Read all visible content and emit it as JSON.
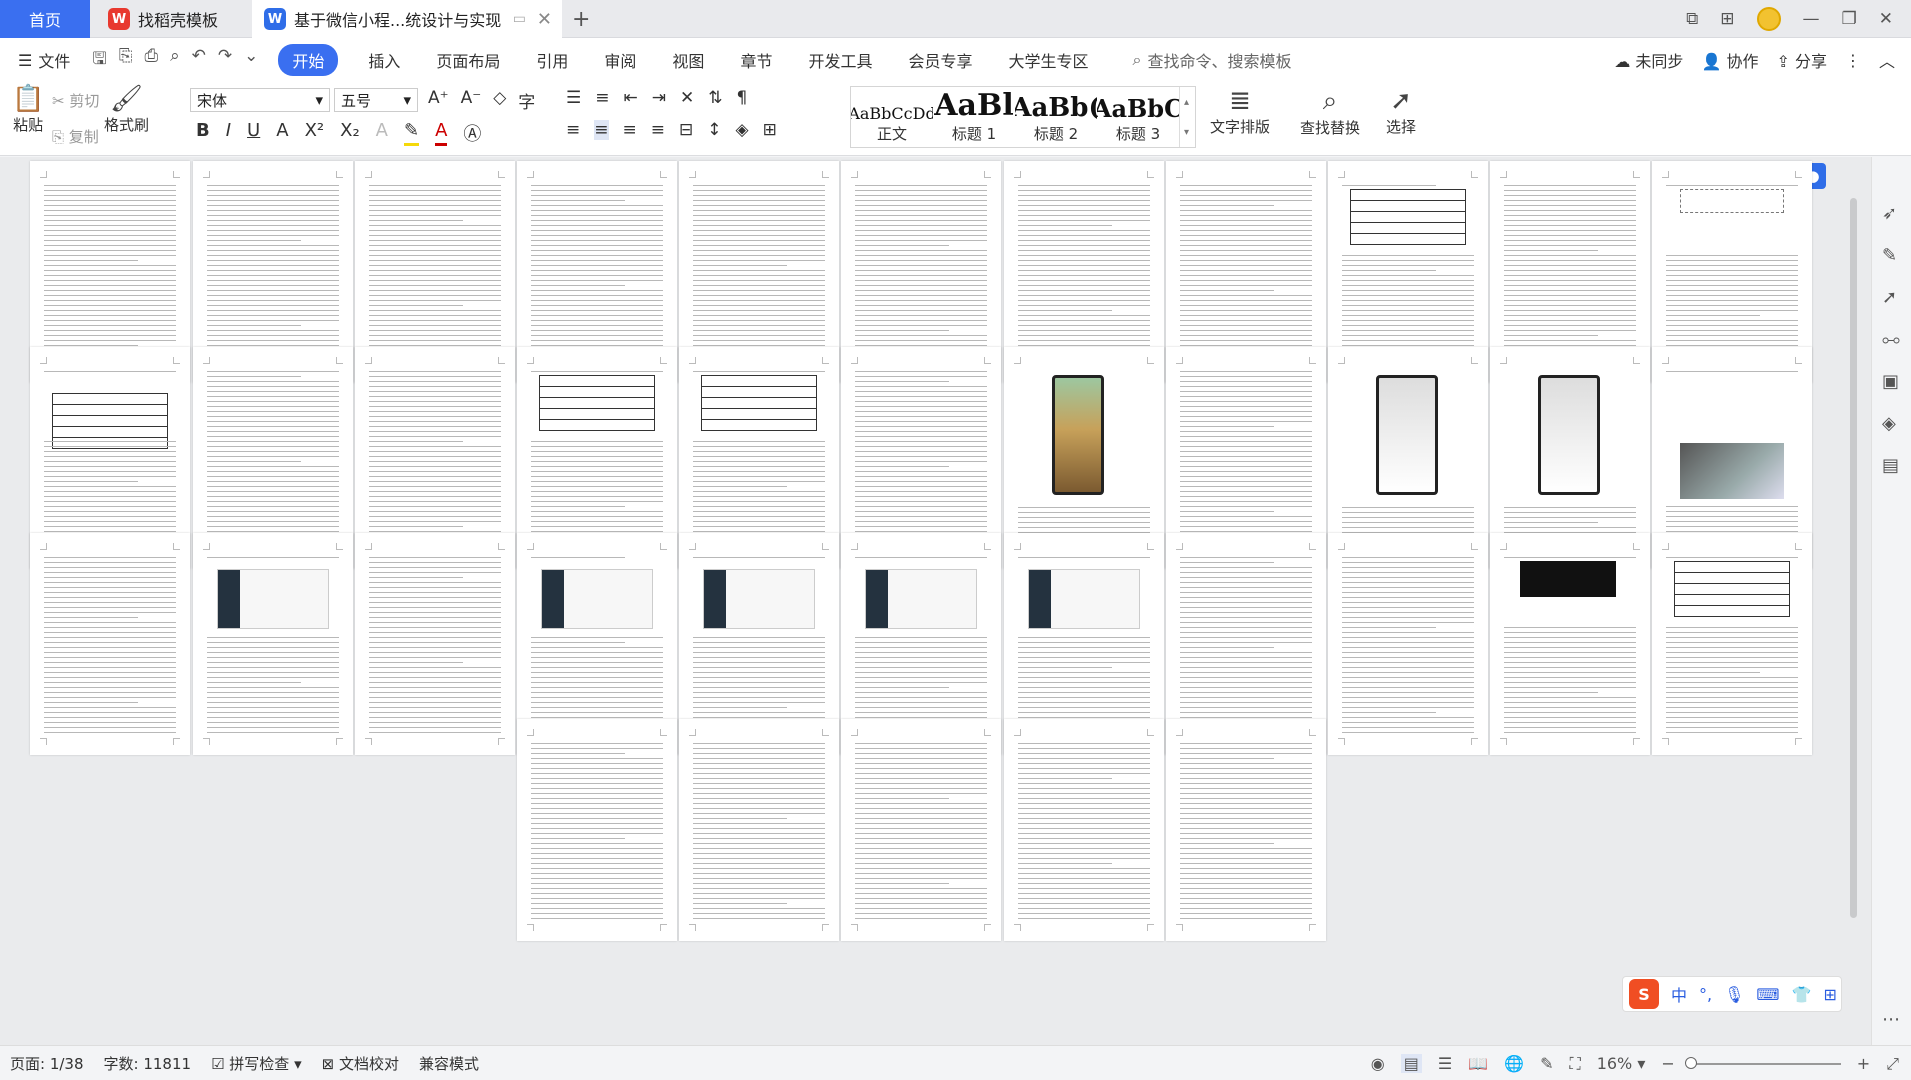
{
  "tabs": {
    "home": "首页",
    "daoke": "找稻壳模板",
    "doc": "基于微信小程...统设计与实现",
    "add": "+"
  },
  "menu": {
    "file": "文件",
    "items": [
      "开始",
      "插入",
      "页面布局",
      "引用",
      "审阅",
      "视图",
      "章节",
      "开发工具",
      "会员专享",
      "大学生专区"
    ],
    "search_placeholder": "查找命令、搜索模板",
    "sync": "未同步",
    "collab": "协作",
    "share": "分享"
  },
  "ribbon": {
    "paste": "粘贴",
    "cut": "剪切",
    "copy": "复制",
    "format_painter": "格式刷",
    "font": "宋体",
    "size": "五号",
    "styles": [
      {
        "preview": "AaBbCcDd",
        "name": "正文"
      },
      {
        "preview": "AaBl",
        "name": "标题 1"
      },
      {
        "preview": "AaBb(",
        "name": "标题 2"
      },
      {
        "preview": "AaBbC",
        "name": "标题 3"
      }
    ],
    "text_layout": "文字排版",
    "find_replace": "查找替换",
    "select": "选择"
  },
  "ime": {
    "mode": "中",
    "punct": "°,"
  },
  "status": {
    "page": "页面: 1/38",
    "words": "字数: 11811",
    "spell": "拼写检查",
    "proof": "文档校对",
    "compat": "兼容模式",
    "zoom": "16%"
  },
  "colors": {
    "accent": "#3a6ff0",
    "wps_red": "#e8392f",
    "ime_orange": "#f04e23"
  }
}
